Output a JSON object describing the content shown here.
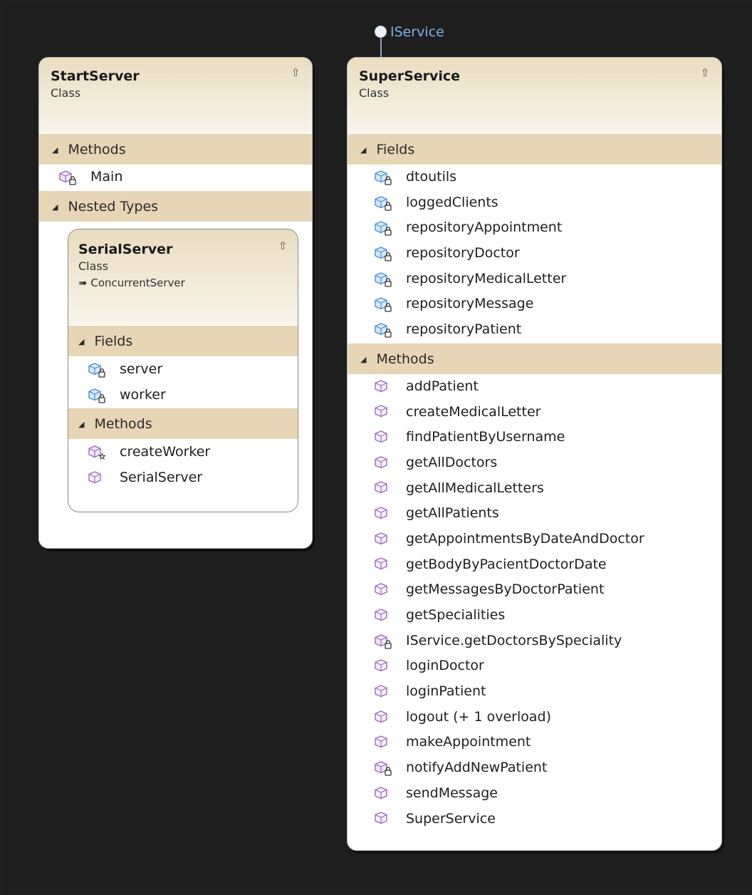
{
  "interface": {
    "name": "IService"
  },
  "start_server": {
    "title": "StartServer",
    "kind": "Class",
    "sections": [
      {
        "label": "Methods",
        "items": [
          {
            "name": "Main",
            "icon": "method-private-icon"
          }
        ]
      },
      {
        "label": "Nested Types"
      }
    ],
    "nested": {
      "title": "SerialServer",
      "kind": "Class",
      "base": "ConcurrentServer",
      "sections": [
        {
          "label": "Fields",
          "items": [
            {
              "name": "server",
              "icon": "field-private-icon"
            },
            {
              "name": "worker",
              "icon": "field-private-icon"
            }
          ]
        },
        {
          "label": "Methods",
          "items": [
            {
              "name": "createWorker",
              "icon": "method-protected-icon"
            },
            {
              "name": "SerialServer",
              "icon": "method-public-icon"
            }
          ]
        }
      ]
    }
  },
  "super_service": {
    "title": "SuperService",
    "kind": "Class",
    "sections": [
      {
        "label": "Fields",
        "items": [
          {
            "name": "dtoutils",
            "icon": "field-private-icon"
          },
          {
            "name": "loggedClients",
            "icon": "field-private-icon"
          },
          {
            "name": "repositoryAppointment",
            "icon": "field-private-icon"
          },
          {
            "name": "repositoryDoctor",
            "icon": "field-private-icon"
          },
          {
            "name": "repositoryMedicalLetter",
            "icon": "field-private-icon"
          },
          {
            "name": "repositoryMessage",
            "icon": "field-private-icon"
          },
          {
            "name": "repositoryPatient",
            "icon": "field-private-icon"
          }
        ]
      },
      {
        "label": "Methods",
        "items": [
          {
            "name": "addPatient",
            "icon": "method-public-icon"
          },
          {
            "name": "createMedicalLetter",
            "icon": "method-public-icon"
          },
          {
            "name": "findPatientByUsername",
            "icon": "method-public-icon"
          },
          {
            "name": "getAllDoctors",
            "icon": "method-public-icon"
          },
          {
            "name": "getAllMedicalLetters",
            "icon": "method-public-icon"
          },
          {
            "name": "getAllPatients",
            "icon": "method-public-icon"
          },
          {
            "name": "getAppointmentsByDateAndDoctor",
            "icon": "method-public-icon"
          },
          {
            "name": "getBodyByPacientDoctorDate",
            "icon": "method-public-icon"
          },
          {
            "name": "getMessagesByDoctorPatient",
            "icon": "method-public-icon"
          },
          {
            "name": "getSpecialities",
            "icon": "method-public-icon"
          },
          {
            "name": "IService.getDoctorsBySpeciality",
            "icon": "method-private-icon"
          },
          {
            "name": "loginDoctor",
            "icon": "method-public-icon"
          },
          {
            "name": "loginPatient",
            "icon": "method-public-icon"
          },
          {
            "name": "logout (+ 1 overload)",
            "icon": "method-public-icon"
          },
          {
            "name": "makeAppointment",
            "icon": "method-public-icon"
          },
          {
            "name": "notifyAddNewPatient",
            "icon": "method-private-icon"
          },
          {
            "name": "sendMessage",
            "icon": "method-public-icon"
          },
          {
            "name": "SuperService",
            "icon": "method-public-icon"
          }
        ]
      }
    ]
  },
  "colors": {
    "background": "#1e1e1e",
    "header": "#e9dcc0",
    "section": "#e6d6b6",
    "field_icon": "#4a8fd6",
    "method_icon": "#9b6bb8",
    "interface_label": "#7fb0e8"
  }
}
